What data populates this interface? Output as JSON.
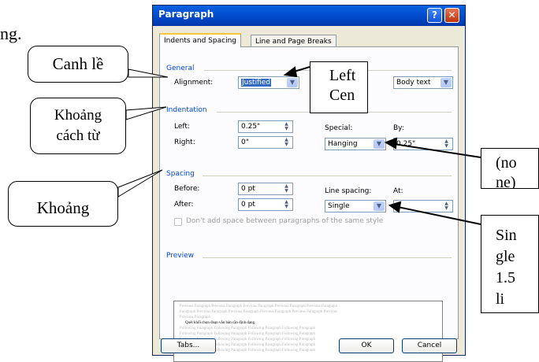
{
  "document_text": "ng.",
  "dialog": {
    "title": "Paragraph",
    "help_button": "?",
    "close_button": "✕",
    "tabs": [
      "Indents and Spacing",
      "Line and Page Breaks"
    ],
    "general": {
      "header": "General",
      "alignment_label": "Alignment:",
      "alignment_value": "Justified",
      "outline_value": "Body text"
    },
    "indentation": {
      "header": "Indentation",
      "left_label": "Left:",
      "left_value": "0.25\"",
      "right_label": "Right:",
      "right_value": "0\"",
      "special_label": "Special:",
      "special_value": "Hanging",
      "by_label": "By:",
      "by_value": "0.25\""
    },
    "spacing": {
      "header": "Spacing",
      "before_label": "Before:",
      "before_value": "0 pt",
      "after_label": "After:",
      "after_value": "0 pt",
      "line_spacing_label": "Line spacing:",
      "line_spacing_value": "Single",
      "at_label": "At:",
      "dont_add_label": "Don't add space between paragraphs of the same style"
    },
    "preview": {
      "header": "Preview",
      "lines": [
        "Previous Paragraph Previous Paragraph Previous Paragraph Previous Paragraph Previous Paragraph",
        "Paragraph Previous Paragraph Previous Paragraph Previous Paragraph Previous Paragraph Previous",
        "Previous Paragraph",
        "Quét khối chọn đoạn văn bản cần định dạng.",
        "Following Paragraph Following Paragraph Following Paragraph Following Paragraph",
        "Following Paragraph Following Paragraph Following Paragraph Following Paragraph",
        "Following Paragraph Following Paragraph Following Paragraph Following Paragraph",
        "Following Paragraph Following Paragraph Following Paragraph Following Paragraph",
        "Following Paragraph Following Paragraph Following Paragraph Following Paragraph"
      ]
    },
    "tabs_button": "Tabs...",
    "ok_button": "OK",
    "cancel_button": "Cancel"
  },
  "callouts": {
    "canh_le": "Canh lề",
    "khoang_cach_line1": "Khoảng",
    "khoang_cach_line2": "cách từ",
    "khoang": "Khoảng",
    "left_cen_line1": "Left",
    "left_cen_line2": "Cen",
    "no_line1": "(no",
    "no_line2": "ne)",
    "sin_line1": "Sin",
    "sin_line2": "gle",
    "sin_line3": "1.5",
    "sin_line4": "li"
  }
}
